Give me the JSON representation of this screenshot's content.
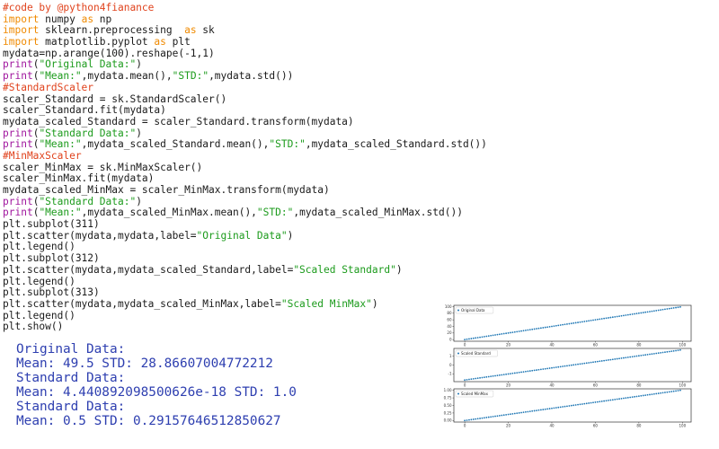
{
  "code": [
    {
      "tokens": [
        {
          "t": "#code by @python4fianance",
          "c": "comment"
        }
      ]
    },
    {
      "tokens": [
        {
          "t": "import",
          "c": "keyword"
        },
        {
          "t": " numpy ",
          "c": "plain"
        },
        {
          "t": "as",
          "c": "keyword"
        },
        {
          "t": " np",
          "c": "plain"
        }
      ]
    },
    {
      "tokens": [
        {
          "t": "import",
          "c": "keyword"
        },
        {
          "t": " sklearn.preprocessing  ",
          "c": "plain"
        },
        {
          "t": "as",
          "c": "keyword"
        },
        {
          "t": " sk",
          "c": "plain"
        }
      ]
    },
    {
      "tokens": [
        {
          "t": "import",
          "c": "keyword"
        },
        {
          "t": " matplotlib.pyplot ",
          "c": "plain"
        },
        {
          "t": "as",
          "c": "keyword"
        },
        {
          "t": " plt",
          "c": "plain"
        }
      ]
    },
    {
      "tokens": [
        {
          "t": "mydata=np.arange(100).reshape(-1,1)",
          "c": "plain"
        }
      ]
    },
    {
      "tokens": [
        {
          "t": "print",
          "c": "print"
        },
        {
          "t": "(",
          "c": "plain"
        },
        {
          "t": "\"Original Data:\"",
          "c": "string"
        },
        {
          "t": ")",
          "c": "plain"
        }
      ]
    },
    {
      "tokens": [
        {
          "t": "print",
          "c": "print"
        },
        {
          "t": "(",
          "c": "plain"
        },
        {
          "t": "\"Mean:\"",
          "c": "string"
        },
        {
          "t": ",mydata.mean(),",
          "c": "plain"
        },
        {
          "t": "\"STD:\"",
          "c": "string"
        },
        {
          "t": ",mydata.std())",
          "c": "plain"
        }
      ]
    },
    {
      "tokens": [
        {
          "t": "#StandardScaler",
          "c": "comment"
        }
      ]
    },
    {
      "tokens": [
        {
          "t": "scaler_Standard = sk.StandardScaler()",
          "c": "plain"
        }
      ]
    },
    {
      "tokens": [
        {
          "t": "scaler_Standard.fit(mydata)",
          "c": "plain"
        }
      ]
    },
    {
      "tokens": [
        {
          "t": "mydata_scaled_Standard = scaler_Standard.transform(mydata)",
          "c": "plain"
        }
      ]
    },
    {
      "tokens": [
        {
          "t": "print",
          "c": "print"
        },
        {
          "t": "(",
          "c": "plain"
        },
        {
          "t": "\"Standard Data:\"",
          "c": "string"
        },
        {
          "t": ")",
          "c": "plain"
        }
      ]
    },
    {
      "tokens": [
        {
          "t": "print",
          "c": "print"
        },
        {
          "t": "(",
          "c": "plain"
        },
        {
          "t": "\"Mean:\"",
          "c": "string"
        },
        {
          "t": ",mydata_scaled_Standard.mean(),",
          "c": "plain"
        },
        {
          "t": "\"STD:\"",
          "c": "string"
        },
        {
          "t": ",mydata_scaled_Standard.std())",
          "c": "plain"
        }
      ]
    },
    {
      "tokens": [
        {
          "t": "#MinMaxScaler",
          "c": "comment"
        }
      ]
    },
    {
      "tokens": [
        {
          "t": "scaler_MinMax = sk.MinMaxScaler()",
          "c": "plain"
        }
      ]
    },
    {
      "tokens": [
        {
          "t": "scaler_MinMax.fit(mydata)",
          "c": "plain"
        }
      ]
    },
    {
      "tokens": [
        {
          "t": "mydata_scaled_MinMax = scaler_MinMax.transform(mydata)",
          "c": "plain"
        }
      ]
    },
    {
      "tokens": [
        {
          "t": "print",
          "c": "print"
        },
        {
          "t": "(",
          "c": "plain"
        },
        {
          "t": "\"Standard Data:\"",
          "c": "string"
        },
        {
          "t": ")",
          "c": "plain"
        }
      ]
    },
    {
      "tokens": [
        {
          "t": "print",
          "c": "print"
        },
        {
          "t": "(",
          "c": "plain"
        },
        {
          "t": "\"Mean:\"",
          "c": "string"
        },
        {
          "t": ",mydata_scaled_MinMax.mean(),",
          "c": "plain"
        },
        {
          "t": "\"STD:\"",
          "c": "string"
        },
        {
          "t": ",mydata_scaled_MinMax.std())",
          "c": "plain"
        }
      ]
    },
    {
      "tokens": [
        {
          "t": "plt.subplot(311)",
          "c": "plain"
        }
      ]
    },
    {
      "tokens": [
        {
          "t": "plt.scatter(mydata,mydata,label=",
          "c": "plain"
        },
        {
          "t": "\"Original Data\"",
          "c": "string"
        },
        {
          "t": ")",
          "c": "plain"
        }
      ]
    },
    {
      "tokens": [
        {
          "t": "plt.legend()",
          "c": "plain"
        }
      ]
    },
    {
      "tokens": [
        {
          "t": "plt.subplot(312)",
          "c": "plain"
        }
      ]
    },
    {
      "tokens": [
        {
          "t": "plt.scatter(mydata,mydata_scaled_Standard,label=",
          "c": "plain"
        },
        {
          "t": "\"Scaled Standard\"",
          "c": "string"
        },
        {
          "t": ")",
          "c": "plain"
        }
      ]
    },
    {
      "tokens": [
        {
          "t": "plt.legend()",
          "c": "plain"
        }
      ]
    },
    {
      "tokens": [
        {
          "t": "plt.subplot(313)",
          "c": "plain"
        }
      ]
    },
    {
      "tokens": [
        {
          "t": "plt.scatter(mydata,mydata_scaled_MinMax,label=",
          "c": "plain"
        },
        {
          "t": "\"Scaled MinMax\"",
          "c": "string"
        },
        {
          "t": ")",
          "c": "plain"
        }
      ]
    },
    {
      "tokens": [
        {
          "t": "plt.legend()",
          "c": "plain"
        }
      ]
    },
    {
      "tokens": [
        {
          "t": "plt.show()",
          "c": "plain"
        }
      ]
    }
  ],
  "output": [
    "Original Data:",
    "Mean: 49.5 STD: 28.86607004772212",
    "Standard Data:",
    "Mean: 4.440892098500626e-18 STD: 1.0",
    "Standard Data:",
    "Mean: 0.5 STD: 0.29157646512850627"
  ],
  "colors": {
    "comment": "#e0421c",
    "keyword": "#f08a00",
    "print": "#a0169e",
    "string": "#1c9b1c",
    "plain": "#1a1a1a",
    "output": "#2e3fb0",
    "marker": "#1f77b4"
  },
  "chart_data": [
    {
      "type": "scatter",
      "legend": "Original Data",
      "legend_placement": "top-left",
      "x": {
        "start": 0,
        "stop": 99,
        "step": 1
      },
      "y_formula": "y = x",
      "xlim": [
        -5,
        104
      ],
      "ylim": [
        -5,
        104
      ],
      "xticks": [
        "0",
        "20",
        "40",
        "60",
        "80",
        "100"
      ],
      "xtick_values": [
        0,
        20,
        40,
        60,
        80,
        100
      ],
      "yticks": [
        "0",
        "20",
        "40",
        "60",
        "80",
        "100"
      ],
      "ytick_values": [
        0,
        20,
        40,
        60,
        80,
        100
      ],
      "grid": false
    },
    {
      "type": "scatter",
      "legend": "Scaled Standard",
      "legend_placement": "top-left",
      "x": {
        "start": 0,
        "stop": 99,
        "step": 1
      },
      "y_formula": "y = (x - 49.5) / 28.86607004772212",
      "xlim": [
        -5,
        104
      ],
      "ylim": [
        -1.9,
        1.9
      ],
      "xticks": [
        "0",
        "20",
        "40",
        "60",
        "80",
        "100"
      ],
      "xtick_values": [
        0,
        20,
        40,
        60,
        80,
        100
      ],
      "yticks": [
        "-1",
        "0",
        "1"
      ],
      "ytick_values": [
        -1,
        0,
        1
      ],
      "grid": false
    },
    {
      "type": "scatter",
      "legend": "Scaled MinMax",
      "legend_placement": "top-left",
      "x": {
        "start": 0,
        "stop": 99,
        "step": 1
      },
      "y_formula": "y = x / 99",
      "xlim": [
        -5,
        104
      ],
      "ylim": [
        -0.05,
        1.05
      ],
      "xticks": [
        "0",
        "20",
        "40",
        "60",
        "80",
        "100"
      ],
      "xtick_values": [
        0,
        20,
        40,
        60,
        80,
        100
      ],
      "yticks": [
        "0.00",
        "0.25",
        "0.50",
        "0.75",
        "1.00"
      ],
      "ytick_values": [
        0,
        0.25,
        0.5,
        0.75,
        1.0
      ],
      "grid": false
    }
  ]
}
